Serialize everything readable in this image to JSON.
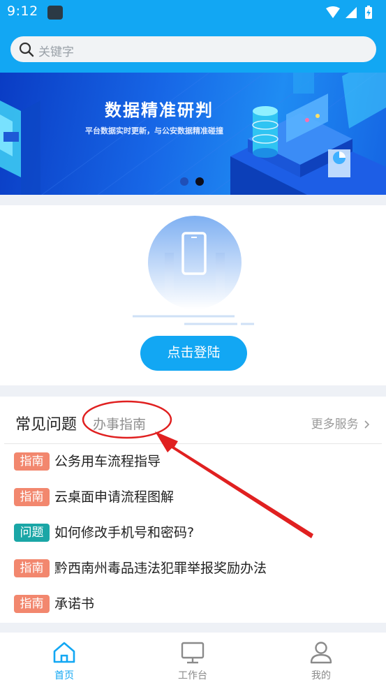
{
  "status_bar": {
    "time": "9:12"
  },
  "search": {
    "placeholder": "关键字"
  },
  "banner": {
    "title": "数据精准研判",
    "subtitle": "平台数据实时更新，与公安数据精准碰撞",
    "slide_count": 2,
    "active_slide": 2
  },
  "login": {
    "button_label": "点击登陆"
  },
  "faq": {
    "tab_active": "常见问题",
    "tab_inactive": "办事指南",
    "more_label": "更多服务",
    "items": [
      {
        "tag": "指南",
        "tag_type": "guide",
        "text": "公务用车流程指导"
      },
      {
        "tag": "指南",
        "tag_type": "guide",
        "text": "云桌面申请流程图解"
      },
      {
        "tag": "问题",
        "tag_type": "question",
        "text": "如何修改手机号和密码?"
      },
      {
        "tag": "指南",
        "tag_type": "guide",
        "text": "黔西南州毒品违法犯罪举报奖励办法"
      },
      {
        "tag": "指南",
        "tag_type": "guide",
        "text": "承诺书"
      }
    ]
  },
  "bottom_nav": {
    "items": [
      {
        "label": "首页",
        "icon": "home-icon",
        "active": true
      },
      {
        "label": "工作台",
        "icon": "monitor-icon",
        "active": false
      },
      {
        "label": "我的",
        "icon": "user-icon",
        "active": false
      }
    ]
  },
  "colors": {
    "primary": "#12a7f3",
    "guide_tag": "#f2876e",
    "question_tag": "#1aa6a6",
    "annotation": "#e02020"
  }
}
